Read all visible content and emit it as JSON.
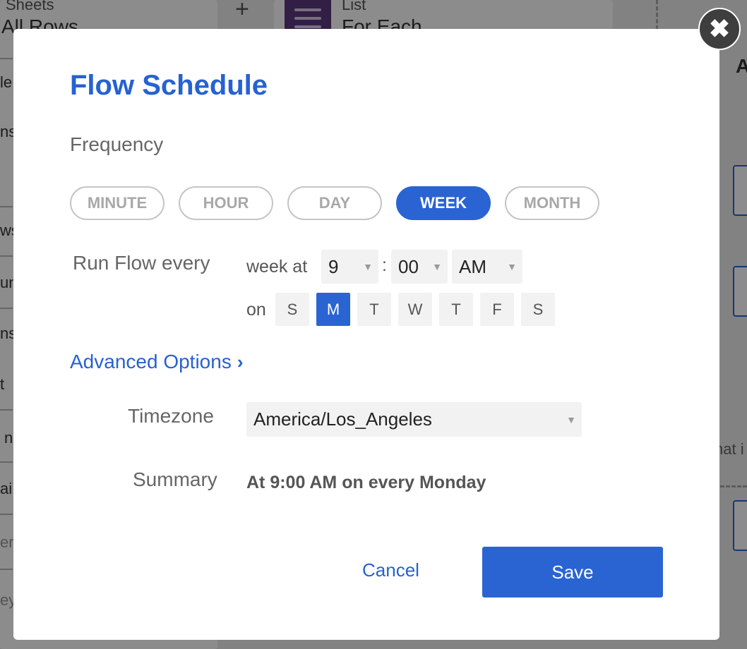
{
  "background": {
    "left_card_title": "Sheets",
    "left_card_subtitle": "All Rows",
    "center_card_title": "List",
    "center_card_subtitle": "For Each",
    "right_partial_letter": "A",
    "right_partial_text": "hat i",
    "left_fragments": [
      "le",
      "ns",
      "ws",
      "un",
      "ns",
      "t",
      "n",
      "ai",
      "er",
      "ey"
    ]
  },
  "modal": {
    "title": "Flow Schedule",
    "close_icon": "✖",
    "frequency_label": "Frequency",
    "frequency_options": [
      "MINUTE",
      "HOUR",
      "DAY",
      "WEEK",
      "MONTH"
    ],
    "frequency_selected": "WEEK",
    "run_flow_label": "Run Flow every",
    "run_flow_unit_text": "week at",
    "hour_value": "9",
    "time_separator": ":",
    "minute_value": "00",
    "ampm_value": "AM",
    "on_label": "on",
    "days": [
      "S",
      "M",
      "T",
      "W",
      "T",
      "F",
      "S"
    ],
    "selected_day_index": 1,
    "advanced_options_label": "Advanced Options",
    "timezone_label": "Timezone",
    "timezone_value": "America/Los_Angeles",
    "summary_label": "Summary",
    "summary_value": "At 9:00 AM on every Monday",
    "cancel_label": "Cancel",
    "save_label": "Save"
  },
  "colors": {
    "accent": "#2a64d3",
    "title_blue": "#2662d1",
    "list_icon_purple": "#5d3a7e"
  },
  "icons": {
    "close": "close-icon",
    "chevron": "chevron-right-icon",
    "caret": "caret-down-icon",
    "plus": "plus-icon",
    "list": "list-icon"
  }
}
